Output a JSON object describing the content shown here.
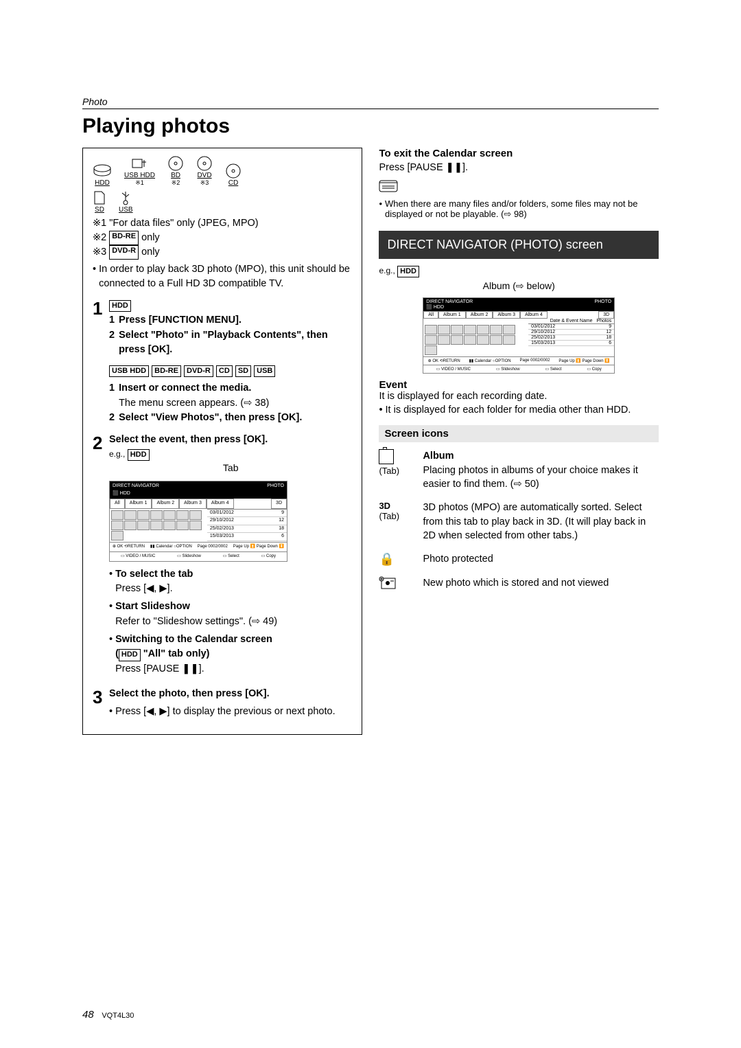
{
  "header_section": "Photo",
  "title": "Playing photos",
  "media": {
    "hdd": "HDD",
    "usbhdd": "USB HDD",
    "bd": "BD",
    "dvd": "DVD",
    "cd": "CD",
    "sd": "SD",
    "usb": "USB",
    "sup1": "※1",
    "sup2": "※2",
    "sup3": "※3"
  },
  "notes": {
    "n1_pre": "※1",
    "n1": "\"For data files\" only (JPEG, MPO)",
    "n2_pre": "※2",
    "n2_box": "BD-RE",
    "n2_post": " only",
    "n3_pre": "※3",
    "n3_box": "DVD-R",
    "n3_post": " only",
    "bullet": "In order to play back 3D photo (MPO), this unit should be connected to a Full HD 3D compatible TV."
  },
  "steps": {
    "s1_num": "1",
    "s1_box": "HDD",
    "s1_1": "Press [FUNCTION MENU].",
    "s1_2": "Select \"Photo\" in \"Playback Contents\", then press [OK].",
    "s1_boxes": [
      "USB HDD",
      "BD-RE",
      "DVD-R",
      "CD",
      "SD",
      "USB"
    ],
    "s1_3": "Insert or connect the media.",
    "s1_3_sub": "The menu screen appears. (⇨ 38)",
    "s1_4": "Select \"View Photos\", then press [OK].",
    "s2_num": "2",
    "s2_text": "Select the event, then press [OK].",
    "s2_eg": "e.g., ",
    "s2_eg_box": "HDD",
    "tab_label": "Tab",
    "bullet_select": "To select the tab",
    "bullet_select_sub": "Press [◀, ▶].",
    "bullet_slide": "Start Slideshow",
    "bullet_slide_sub": "Refer to \"Slideshow settings\". (⇨ 49)",
    "bullet_cal": "Switching to the Calendar screen",
    "bullet_cal_sub1": "(",
    "bullet_cal_box": "HDD",
    "bullet_cal_sub2": " \"All\" tab only)",
    "bullet_cal_sub3": "Press [PAUSE ❚❚].",
    "s3_num": "3",
    "s3_text": "Select the photo, then press [OK].",
    "s3_sub": "Press [◀, ▶] to display the previous or next photo."
  },
  "right": {
    "exit_head": "To exit the Calendar screen",
    "exit_text": "Press [PAUSE ❚❚].",
    "note": "When there are many files and/or folders, some files may not be displayed or not be playable. (⇨ 98)",
    "band": "DIRECT NAVIGATOR (PHOTO) screen",
    "eg": "e.g., ",
    "eg_box": "HDD",
    "album_arrow": "Album (⇨ below)",
    "event_head": "Event",
    "event_t1": "It is displayed for each recording date.",
    "event_t2": "It is displayed for each folder for media other than HDD.",
    "icons_head": "Screen icons",
    "row1_label": "(Tab)",
    "row1_title": "Album",
    "row1_text": "Placing photos in albums of your choice makes it easier to find them. (⇨ 50)",
    "row2_label1": "3D",
    "row2_label2": "(Tab)",
    "row2_text": "3D photos (MPO) are automatically sorted. Select from this tab to play back in 3D. (It will play back in 2D when selected from other tabs.)",
    "row3_text": "Photo protected",
    "row4_text": "New photo which is stored and not viewed"
  },
  "nav": {
    "header_l": "DIRECT NAVIGATOR",
    "header_sub": "⬛ HDD",
    "header_r": "PHOTO",
    "tabs": [
      "All",
      "Album 1",
      "Album 2",
      "Album 3",
      "Album 4",
      "3D"
    ],
    "col_head": "Date & Event Name",
    "col_head_r": "Photos",
    "rows": [
      {
        "d": "03/01/2012",
        "n": "9"
      },
      {
        "d": "29/10/2012",
        "n": "12"
      },
      {
        "d": "25/02/2013",
        "n": "18"
      },
      {
        "d": "15/03/2013",
        "n": "6"
      }
    ],
    "ctrl_ok": "OK",
    "ctrl_ret": "RETURN",
    "ctrl_cal": "Calendar",
    "ctrl_opt": "OPTION",
    "page": "Page 0002/0002",
    "page_up": "Page Up",
    "page_dn": "Page Down",
    "btm": [
      "VIDEO / MUSIC",
      "Slideshow",
      "Select",
      "Copy"
    ]
  },
  "footer": {
    "page": "48",
    "code": "VQT4L30"
  }
}
